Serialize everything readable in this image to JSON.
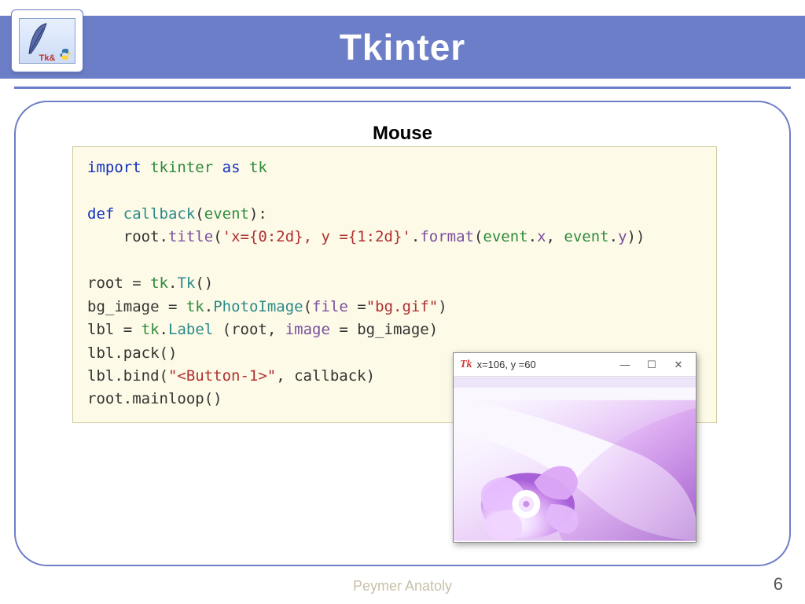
{
  "header": {
    "title": "Tkinter"
  },
  "logo": {
    "text": "Tk&"
  },
  "subtitle": "Mouse",
  "code": {
    "l1": {
      "import": "import",
      "module": "tkinter",
      "as": "as",
      "alias": "tk"
    },
    "l3": {
      "def": "def",
      "fn": "callback",
      "paren_open": "(",
      "param": "event",
      "paren_close": "):"
    },
    "l4": {
      "indent": "    ",
      "obj": "root",
      "dot": ".",
      "method": "title",
      "open": "(",
      "str": "'x={0:2d}, y ={1:2d}'",
      "dot2": ".",
      "format": "format",
      "open2": "(",
      "arg1a": "event",
      "dot3": ".",
      "arg1b": "x",
      "comma": ", ",
      "arg2a": "event",
      "dot4": ".",
      "arg2b": "y",
      "close": "))"
    },
    "l6": {
      "lhs": "root",
      "eq": " = ",
      "mod": "tk",
      "dot": ".",
      "cls": "Tk",
      "call": "()"
    },
    "l7": {
      "lhs": "bg_image",
      "eq": " = ",
      "mod": "tk",
      "dot": ".",
      "cls": "PhotoImage",
      "open": "(",
      "kw": "file",
      "mid": " =",
      "str": "\"bg.gif\"",
      "close": ")"
    },
    "l8": {
      "lhs": "lbl",
      "eq": " = ",
      "mod": "tk",
      "dot": ".",
      "cls": "Label",
      "rest1": " (root, ",
      "kw": "image",
      "rest2": " = bg_image)"
    },
    "l9": {
      "text": "lbl.pack()"
    },
    "l10": {
      "pre": "lbl.bind(",
      "str": "\"<Button-1>\"",
      "post": ", callback)"
    },
    "l11": {
      "text": "root.mainloop()"
    }
  },
  "tk_window": {
    "title": "x=106, y =60",
    "controls": {
      "min": "—",
      "max": "☐",
      "close": "✕"
    }
  },
  "footer": {
    "author": "Peymer Anatoly",
    "page": "6"
  }
}
